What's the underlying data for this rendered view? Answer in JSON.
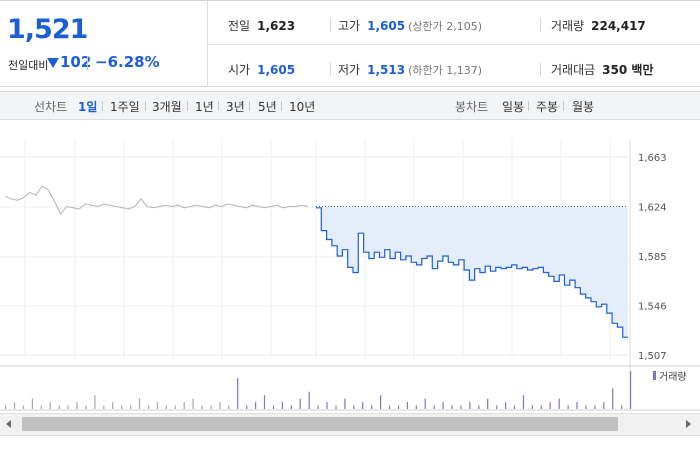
{
  "quote": {
    "price": "1,521",
    "change_label": "전일대비",
    "change_value": "102",
    "change_pct": "−6.28%",
    "prev_close_label": "전일",
    "prev_close": "1,623",
    "open_label": "시가",
    "open": "1,605",
    "high_label": "고가",
    "high": "1,605",
    "upper_limit": "(상한가 2,105)",
    "low_label": "저가",
    "low": "1,513",
    "lower_limit": "(하한가 1,137)",
    "volume_label": "거래량",
    "volume": "224,417",
    "amount_label": "거래대금",
    "amount": "350 백만"
  },
  "period_bar": {
    "line_chart_label": "선차트",
    "periods": [
      "1일",
      "1주일",
      "3개월",
      "1년",
      "3년",
      "5년",
      "10년"
    ],
    "selected_period": "1일",
    "candle_chart_label": "봉차트",
    "candles": [
      "일봉",
      "주봉",
      "월봉"
    ]
  },
  "colors": {
    "accent": "#1c5ed6",
    "down": "#1c5ed6",
    "area_fill": "#e4eefb",
    "prev_line": "#b5b5b5",
    "volume": "#8b6fc7"
  },
  "chart_data": {
    "type": "line",
    "y_ticks": [
      "1,663",
      "1,624",
      "1,585",
      "1,546",
      "1,507"
    ],
    "ylim": [
      1507,
      1663
    ],
    "reference_value": 1624,
    "volume_label": "거래량",
    "prev_series": [
      1632,
      1630,
      1629,
      1631,
      1635,
      1633,
      1640,
      1637,
      1628,
      1618,
      1624,
      1623,
      1622,
      1626,
      1625,
      1624,
      1626,
      1625,
      1624,
      1623,
      1622,
      1624,
      1630,
      1624,
      1623,
      1624,
      1625,
      1624,
      1625,
      1623,
      1624,
      1625,
      1624,
      1623,
      1625,
      1624,
      1626,
      1625,
      1624,
      1623,
      1625,
      1624,
      1623,
      1624,
      1625,
      1623,
      1624,
      1624,
      1625,
      1624
    ],
    "today_series": [
      1623,
      1605,
      1598,
      1593,
      1585,
      1590,
      1576,
      1572,
      1603,
      1588,
      1583,
      1588,
      1584,
      1590,
      1583,
      1588,
      1582,
      1585,
      1580,
      1578,
      1583,
      1585,
      1575,
      1581,
      1585,
      1580,
      1578,
      1582,
      1574,
      1566,
      1575,
      1572,
      1577,
      1573,
      1576,
      1575,
      1576,
      1578,
      1575,
      1576,
      1574,
      1575,
      1576,
      1572,
      1569,
      1565,
      1570,
      1562,
      1566,
      1560,
      1555,
      1552,
      1549,
      1545,
      1547,
      1540,
      1532,
      1529,
      1521,
      1521
    ],
    "volume_series": [
      1,
      2,
      1,
      3,
      1,
      2,
      1,
      1,
      2,
      1,
      4,
      1,
      2,
      1,
      1,
      3,
      1,
      2,
      1,
      1,
      2,
      3,
      1,
      1,
      2,
      1,
      9,
      1,
      2,
      4,
      1,
      2,
      1,
      3,
      5,
      1,
      2,
      1,
      3,
      1,
      2,
      1,
      4,
      1,
      1,
      2,
      1,
      3,
      1,
      2,
      1,
      1,
      2,
      1,
      3,
      1,
      2,
      1,
      4,
      1,
      1,
      2,
      3,
      1,
      2,
      1,
      1,
      2,
      6,
      1,
      11
    ]
  }
}
